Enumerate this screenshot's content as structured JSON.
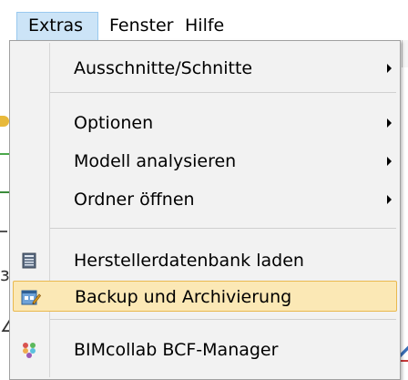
{
  "menubar": {
    "items": [
      {
        "label": "Extras",
        "active": true
      },
      {
        "label": "Fenster",
        "active": false
      },
      {
        "label": "Hilfe",
        "active": false
      }
    ]
  },
  "dropdown": {
    "items": [
      {
        "label": "Ausschnitte/Schnitte",
        "submenu": true,
        "icon": null
      },
      {
        "label": "Optionen",
        "submenu": true,
        "icon": null
      },
      {
        "label": "Modell analysieren",
        "submenu": true,
        "icon": null
      },
      {
        "label": "Ordner öffnen",
        "submenu": true,
        "icon": null
      },
      {
        "label": "Herstellerdatenbank laden",
        "submenu": false,
        "icon": "database-list-icon"
      },
      {
        "label": "Backup und Archivierung",
        "submenu": false,
        "icon": "backup-archive-icon",
        "highlighted": true
      },
      {
        "label": "BIMcollab BCF-Manager",
        "submenu": false,
        "icon": "bimcollab-icon"
      }
    ]
  },
  "colors": {
    "menubar_active_bg": "#cce4f7",
    "menubar_active_border": "#99c9ef",
    "menu_bg": "#f2f2f2",
    "highlight_bg": "#fbe8b5",
    "highlight_border": "#e9b94f"
  }
}
